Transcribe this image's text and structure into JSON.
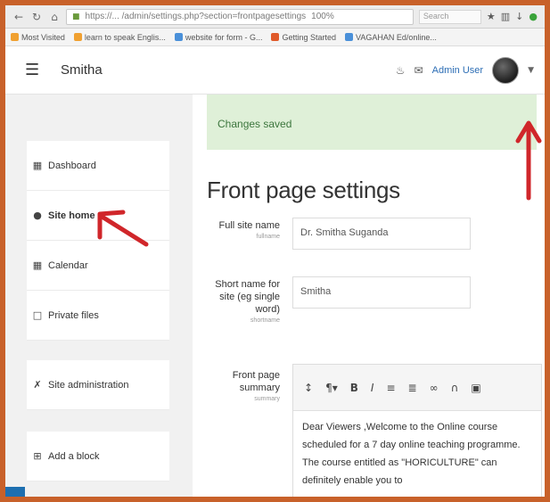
{
  "browser": {
    "url": "https://... /admin/settings.php?section=frontpagesettings",
    "zoom": "100%",
    "search_placeholder": "Search"
  },
  "bookmarks": [
    {
      "label": "Most Visited",
      "color": "#f0a030"
    },
    {
      "label": "learn to speak Englis...",
      "color": "#f0a030"
    },
    {
      "label": "website for form - G...",
      "color": "#4a90d9"
    },
    {
      "label": "Getting Started",
      "color": "#e05a2a"
    },
    {
      "label": "VAGAHAN Ed/online...",
      "color": "#4a90d9"
    }
  ],
  "navbar": {
    "site_name": "Smitha",
    "user_name": "Admin User"
  },
  "sidebar": {
    "items": [
      {
        "label": "Dashboard",
        "icon": "dashboard-icon"
      },
      {
        "label": "Site home",
        "icon": "home-icon"
      },
      {
        "label": "Calendar",
        "icon": "calendar-icon"
      },
      {
        "label": "Private files",
        "icon": "file-icon"
      },
      {
        "label": "Site administration",
        "icon": "wrench-icon"
      },
      {
        "label": "Add a block",
        "icon": "plus-square-icon"
      }
    ]
  },
  "main": {
    "alert": "Changes saved",
    "heading": "Front page settings",
    "fields": {
      "fullname_label": "Full site name",
      "fullname_sub": "fullname",
      "fullname_value": "Dr. Smitha Suganda",
      "shortname_label": "Short name for site (eg single word)",
      "shortname_sub": "shortname",
      "shortname_value": "Smitha",
      "summary_label": "Front page summary",
      "summary_sub": "summary",
      "summary_text": "Dear Viewers ,Welcome to the Online course scheduled for a 7 day online teaching programme. The course entitled as \"HORICULTURE\" can definitely enable you to"
    }
  },
  "colors": {
    "frame": "#c8612a",
    "alert_bg": "#dff0d8",
    "alert_text": "#3c763d",
    "link": "#2d6eb5",
    "arrow": "#d0262a"
  }
}
